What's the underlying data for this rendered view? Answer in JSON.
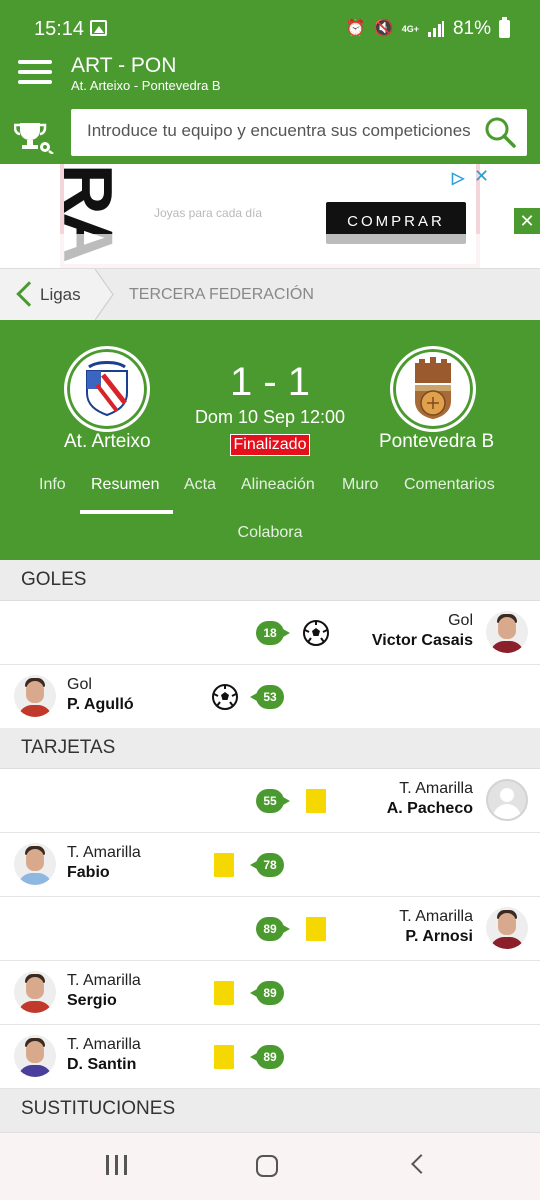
{
  "status_bar": {
    "time": "15:14",
    "network": "4G+",
    "battery": "81%"
  },
  "header": {
    "title": "ART - PON",
    "subtitle": "At. Arteixo - Pontevedra B",
    "search_placeholder": "Introduce tu equipo y encuentra sus competiciones"
  },
  "ad": {
    "text": "Joyas para cada día",
    "button": "COMPRAR",
    "close": "✕",
    "choice_close": "✕"
  },
  "breadcrumb": {
    "back": "Ligas",
    "current": "TERCERA FEDERACIÓN"
  },
  "match": {
    "home_team": "At. Arteixo",
    "away_team": "Pontevedra B",
    "score": "1 - 1",
    "date": "Dom 10 Sep 12:00",
    "status": "Finalizado",
    "tabs": [
      "Info",
      "Resumen",
      "Acta",
      "Alineación",
      "Muro",
      "Comentarios"
    ],
    "tab_colabora": "Colabora",
    "active_tab": "Resumen"
  },
  "sections": {
    "goals": "GOLES",
    "cards": "TARJETAS",
    "subs": "SUSTITUCIONES"
  },
  "goals": [
    {
      "side": "away",
      "minute": "18",
      "type": "Gol",
      "player": "Victor Casais"
    },
    {
      "side": "home",
      "minute": "53",
      "type": "Gol",
      "player": "P. Agulló"
    }
  ],
  "cards": [
    {
      "side": "away",
      "minute": "55",
      "type": "T. Amarilla",
      "player": "A. Pacheco"
    },
    {
      "side": "home",
      "minute": "78",
      "type": "T. Amarilla",
      "player": "Fabio"
    },
    {
      "side": "away",
      "minute": "89",
      "type": "T. Amarilla",
      "player": "P. Arnosi"
    },
    {
      "side": "home",
      "minute": "89",
      "type": "T. Amarilla",
      "player": "Sergio"
    },
    {
      "side": "home",
      "minute": "89",
      "type": "T. Amarilla",
      "player": "D. Santin"
    }
  ],
  "colors": {
    "brand_green": "#4b9a30",
    "status_red": "#e5101c",
    "card_yellow": "#f5d800"
  }
}
